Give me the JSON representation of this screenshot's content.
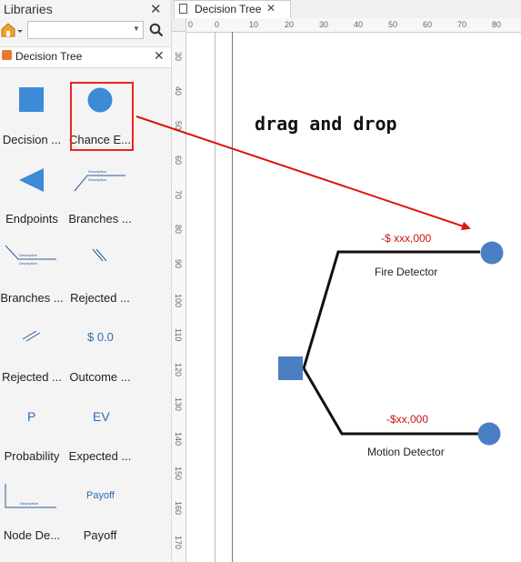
{
  "libraries": {
    "title": "Libraries",
    "search_placeholder": "",
    "category": "Decision Tree",
    "shapes": [
      {
        "label": "Decision ..."
      },
      {
        "label": "Chance E..."
      },
      {
        "label": "Endpoints"
      },
      {
        "label": "Branches ..."
      },
      {
        "label": "Branches ..."
      },
      {
        "label": "Rejected ..."
      },
      {
        "label": "Rejected ..."
      },
      {
        "label": "Outcome ..."
      },
      {
        "label": "Probability"
      },
      {
        "label": "Expected ..."
      },
      {
        "label": "Node De..."
      },
      {
        "label": "Payoff"
      }
    ],
    "glyphs": {
      "outcome": "$ 0.0",
      "probability": "P",
      "expected": "EV",
      "payoff": "Payoff",
      "desc": "Description"
    }
  },
  "document": {
    "tab_label": "Decision Tree",
    "hruler": [
      "0",
      "0",
      "10",
      "20",
      "30",
      "40",
      "50",
      "60",
      "70",
      "80"
    ],
    "vruler": [
      "30",
      "40",
      "50",
      "60",
      "70",
      "80",
      "90",
      "100",
      "110",
      "120",
      "130",
      "140",
      "150",
      "160",
      "170"
    ]
  },
  "canvas": {
    "annotation": "drag and drop",
    "branches": [
      {
        "value": "-$ xxx,000",
        "label": "Fire Detector"
      },
      {
        "value": "-$xx,000",
        "label": "Motion Detector"
      }
    ]
  },
  "colors": {
    "shape_blue": "#3d8ad6",
    "node_blue": "#4b7fc4",
    "arrow_red": "#e01010",
    "money_red": "#c81414"
  }
}
